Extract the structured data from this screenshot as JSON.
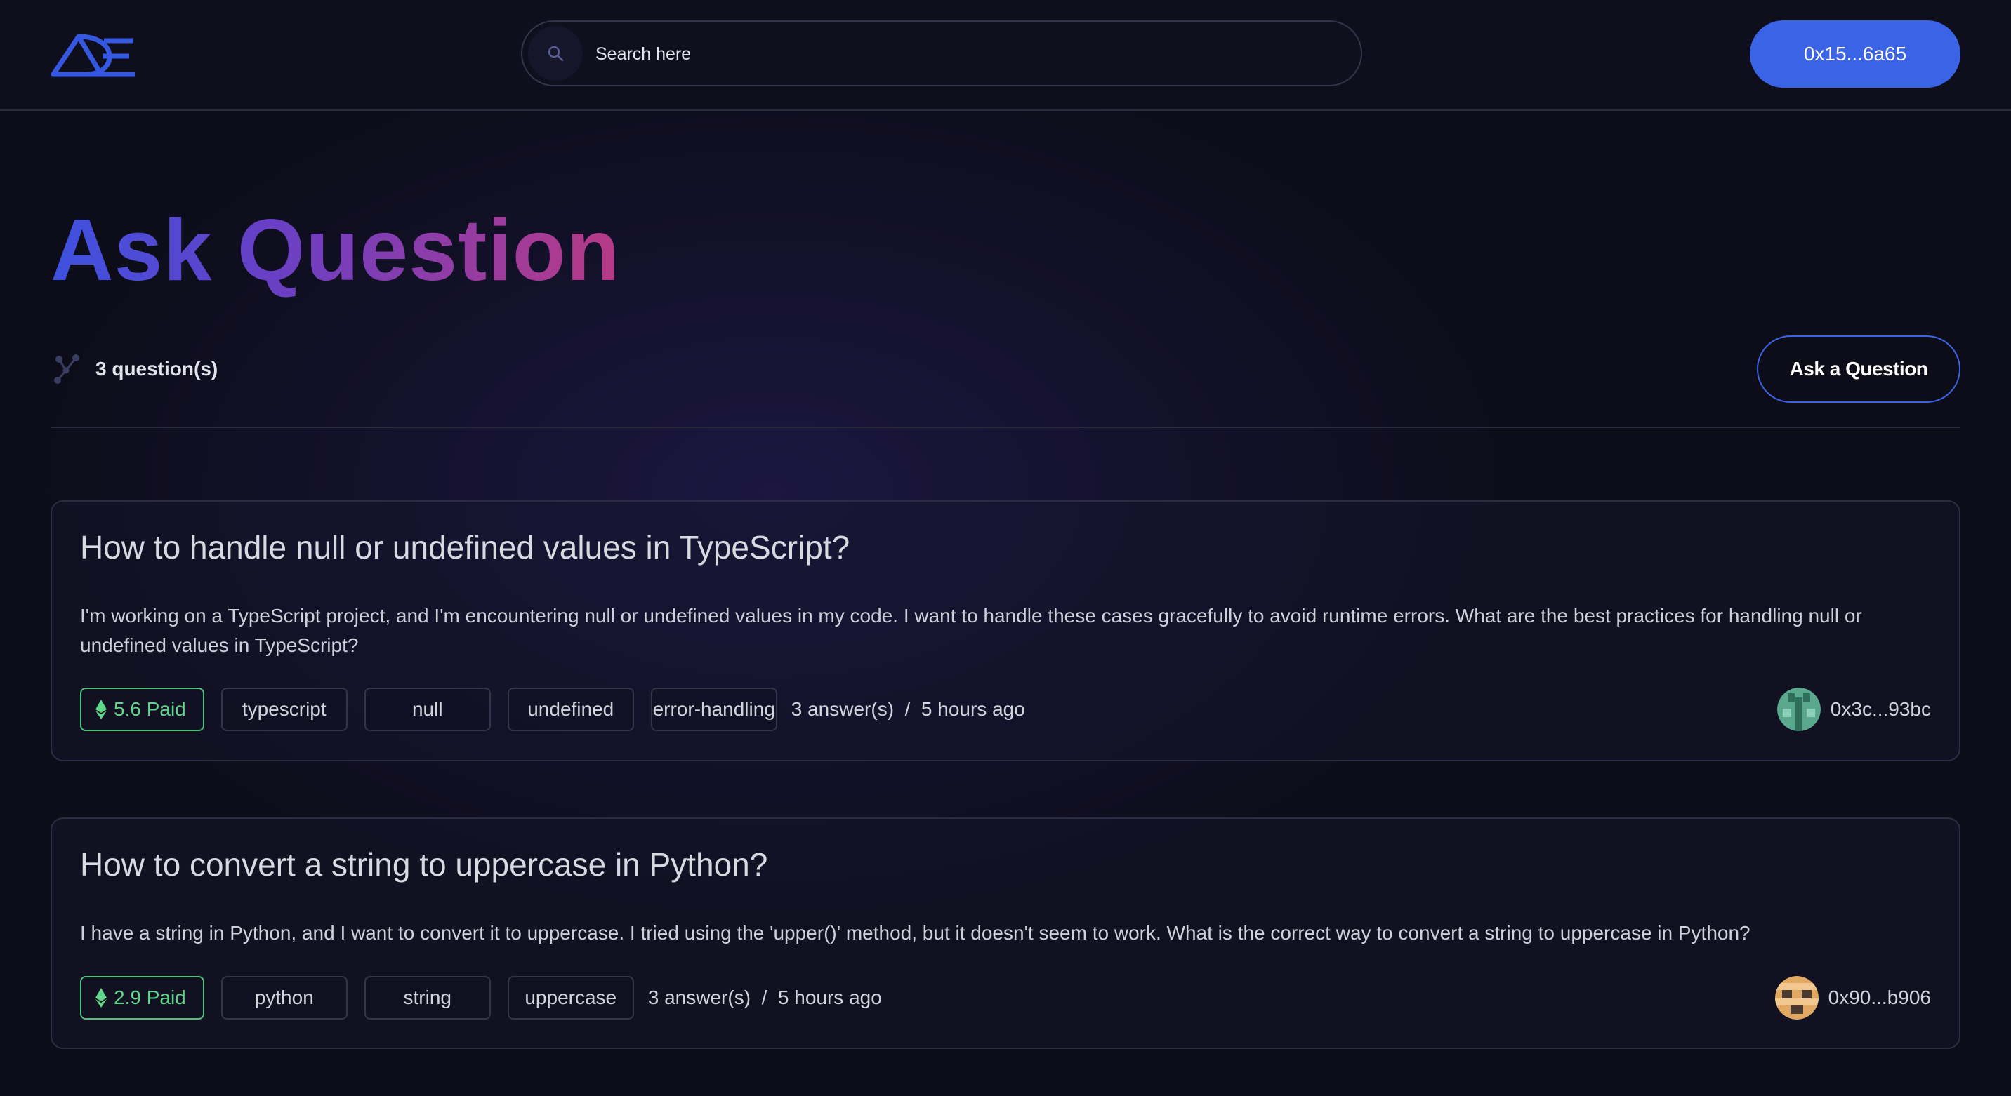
{
  "header": {
    "search_placeholder": "Search here",
    "wallet_label": "0x15...6a65"
  },
  "page": {
    "title": "Ask Question",
    "question_count": "3 question(s)",
    "ask_button": "Ask a Question"
  },
  "questions": [
    {
      "title": "How to handle null or undefined values in TypeScript?",
      "body": "I'm working on a TypeScript project, and I'm encountering null or undefined values in my code. I want to handle these cases gracefully to avoid runtime errors. What are the best practices for handling null or undefined values in TypeScript?",
      "paid": "5.6 Paid",
      "tags": [
        "typescript",
        "null",
        "undefined",
        "error-handling"
      ],
      "meta": "3 answer(s)  /  5 hours ago",
      "author": "0x3c...93bc"
    },
    {
      "title": "How to convert a string to uppercase in Python?",
      "body": "I have a string in Python, and I want to convert it to uppercase. I tried using the 'upper()' method, but it doesn't seem to work. What is the correct way to convert a string to uppercase in Python?",
      "paid": "2.9 Paid",
      "tags": [
        "python",
        "string",
        "uppercase"
      ],
      "meta": "3 answer(s)  /  5 hours ago",
      "author": "0x90...b906"
    }
  ],
  "colors": {
    "accent": "#3b63e6",
    "paid_green": "#5fd68c",
    "background": "#0d0d1a"
  }
}
